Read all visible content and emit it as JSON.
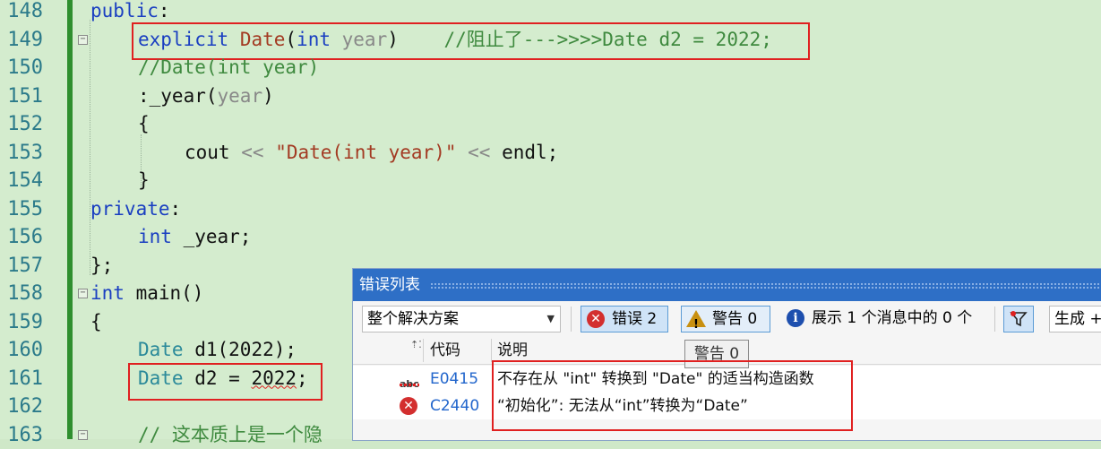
{
  "editor": {
    "lines": [
      {
        "num": "148"
      },
      {
        "num": "149",
        "comment": "//阻止了--->>>>Date d2 = 2022;"
      },
      {
        "num": "150",
        "comment": "//Date(int year)"
      },
      {
        "num": "151"
      },
      {
        "num": "152"
      },
      {
        "num": "153",
        "string": "\"Date(int year)\""
      },
      {
        "num": "154"
      },
      {
        "num": "155"
      },
      {
        "num": "156"
      },
      {
        "num": "157"
      },
      {
        "num": "158"
      },
      {
        "num": "159"
      },
      {
        "num": "160"
      },
      {
        "num": "161"
      },
      {
        "num": "162"
      },
      {
        "num": "163",
        "comment": "// 这本质上是一个隐"
      }
    ],
    "tokens": {
      "public": "public",
      "colon": ":",
      "explicit": "explicit",
      "Date": "Date",
      "open_paren": "(",
      "int": "int",
      "year": "year",
      "close_paren": ")",
      "year_init": ":_year",
      "open_brace": "{",
      "close_brace": "}",
      "cout": "cout",
      "shift": "<<",
      "endl": "endl;",
      "private": "private",
      "year_member": "_year;",
      "class_end": "};",
      "main": "main()",
      "d1": "d1(2022);",
      "d2_decl": "d2 = ",
      "num_2022": "2022",
      "semicolon": ";"
    }
  },
  "error_list": {
    "title": "错误列表",
    "scope_dropdown": "整个解决方案",
    "errors_button": "错误 2",
    "warnings_button": "警告 0",
    "messages_button": "展示 1 个消息中的 0 个",
    "build_dropdown": "生成 +",
    "col_code": "代码",
    "col_desc": "说明",
    "tooltip": "警告 0",
    "rows": [
      {
        "code": "E0415",
        "desc": "不存在从 \"int\" 转换到 \"Date\" 的适当构造函数",
        "icon": "abc-spell-icon"
      },
      {
        "code": "C2440",
        "desc": "“初始化”: 无法从“int”转换为“Date”",
        "icon": "error-icon"
      }
    ]
  }
}
